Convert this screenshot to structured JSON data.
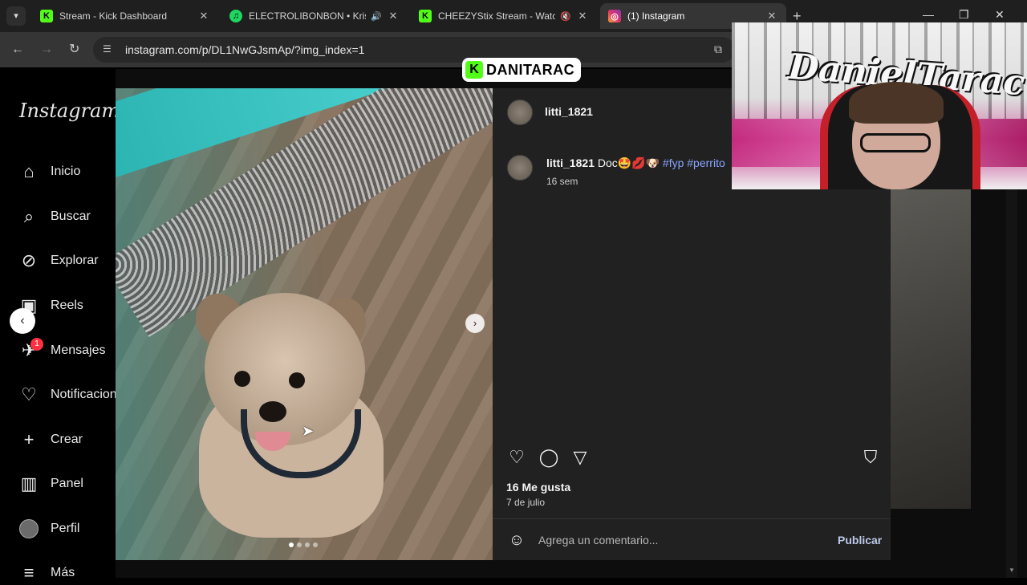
{
  "browser": {
    "tabs": [
      {
        "title": "Stream - Kick Dashboard",
        "favicon": "kick-icon",
        "color": "#53fc18",
        "glyph": "K"
      },
      {
        "title": "ELECTROLIBONBON • Kris R",
        "favicon": "spotify-icon",
        "color": "#1ed760",
        "glyph": "♫"
      },
      {
        "title": "CHEEZYStix Stream - Watch",
        "favicon": "kick-icon",
        "color": "#53fc18",
        "glyph": "K"
      },
      {
        "title": "(1) Instagram",
        "favicon": "instagram-icon",
        "color": "#e1306c",
        "glyph": "◎"
      }
    ],
    "url": "instagram.com/p/DL1NwGJsmAp/?img_index=1"
  },
  "instagram": {
    "logo": "Instagram",
    "nav": [
      {
        "label": "Inicio",
        "icon": "home-icon",
        "glyph": "⌂"
      },
      {
        "label": "Buscar",
        "icon": "search-icon",
        "glyph": "⌕"
      },
      {
        "label": "Explorar",
        "icon": "compass-icon",
        "glyph": "⊘"
      },
      {
        "label": "Reels",
        "icon": "reels-icon",
        "glyph": "▣"
      },
      {
        "label": "Mensajes",
        "icon": "messenger-icon",
        "glyph": "✈",
        "badge": "1"
      },
      {
        "label": "Notificaciones",
        "icon": "heart-icon",
        "glyph": "♡"
      },
      {
        "label": "Crear",
        "icon": "plus-icon",
        "glyph": "+"
      },
      {
        "label": "Panel",
        "icon": "dashboard-icon",
        "glyph": "▥"
      },
      {
        "label": "Perfil",
        "icon": "profile-avatar",
        "glyph": ""
      },
      {
        "label": "Más",
        "icon": "menu-icon",
        "glyph": "≡"
      }
    ],
    "post": {
      "username": "litti_1821",
      "caption_user": "litti_1821",
      "caption_text": "Doc🤩💋🐶",
      "hashtags": "#fyp #perrito",
      "caption_time": "16 sem",
      "likes": "16 Me gusta",
      "date": "7 de julio",
      "comment_placeholder": "Agrega un comentario...",
      "publish": "Publicar",
      "carousel_total": 4,
      "carousel_index": 1
    }
  },
  "stream_overlay": {
    "channel": "DANITARAC",
    "webcam_text": "DanielTarac"
  }
}
